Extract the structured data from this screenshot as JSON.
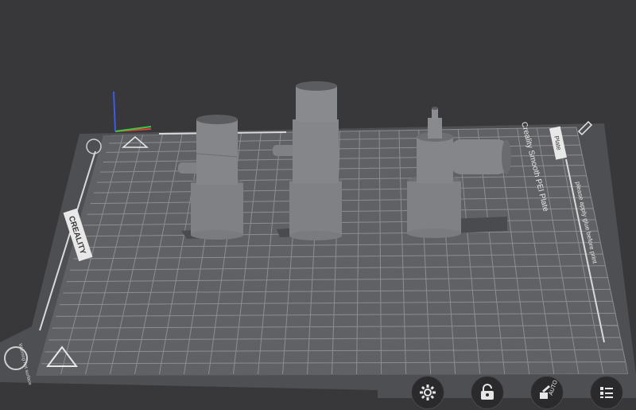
{
  "bed": {
    "brand": "CREALITY",
    "plate_name": "Creality Smooth PEI Plate",
    "notice": "please apply glue before print",
    "tab_label": "Plate",
    "corner_text": "Warning hot surface",
    "colors": {
      "bed_surface": "#5f6063",
      "grid": "#8a8b8e",
      "bed_frame": "#4f5053",
      "background": "#38383b",
      "model": "#7f8083"
    }
  },
  "axes": {
    "x_color": "#e23c3c",
    "y_color": "#3cc93c",
    "z_color": "#3c5de2"
  },
  "models": [
    {
      "name": "left-part"
    },
    {
      "name": "middle-part"
    },
    {
      "name": "right-part"
    }
  ],
  "toolbar": {
    "buttons": [
      {
        "name": "settings-button",
        "icon": "gear-icon"
      },
      {
        "name": "lock-button",
        "icon": "lock-icon"
      },
      {
        "name": "auto-arrange-button",
        "icon": "auto-icon",
        "label": "AUTO"
      },
      {
        "name": "menu-button",
        "icon": "list-icon"
      }
    ]
  }
}
